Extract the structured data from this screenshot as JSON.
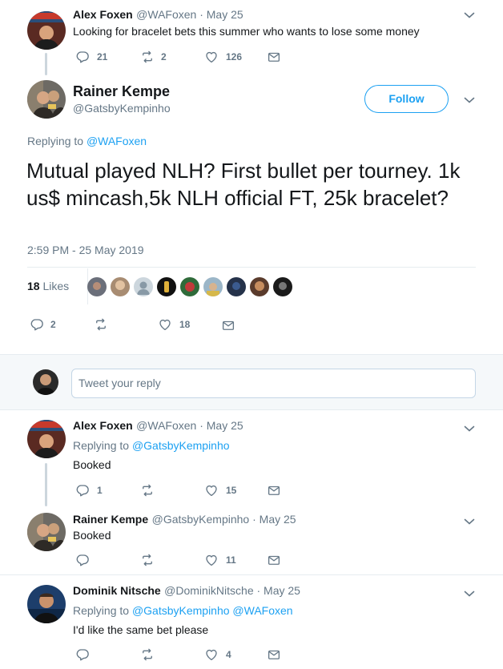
{
  "colors": {
    "accent": "#1da1f2",
    "muted": "#657786",
    "text": "#14171a",
    "divider": "#e6ecf0",
    "reply_bg": "#f5f8fa"
  },
  "tweet1": {
    "name": "Alex Foxen",
    "handle": "@WAFoxen · May 25",
    "text": "Looking for bracelet bets this summer who wants to lose some money",
    "replies": "21",
    "retweets": "2",
    "likes": "126"
  },
  "main": {
    "name": "Rainer Kempe",
    "handle": "@GatsbyKempinho",
    "follow_label": "Follow",
    "replying_prefix": "Replying to ",
    "replying_to": "@WAFoxen",
    "text": "Mutual played NLH? First bullet per tourney. 1k us$ mincash,5k NLH official FT, 25k bracelet?",
    "timestamp": "2:59 PM - 25 May 2019",
    "likes_count": "18",
    "likes_label": "Likes",
    "replies": "2",
    "likes": "18"
  },
  "compose": {
    "placeholder": "Tweet your reply"
  },
  "reply1": {
    "name": "Alex Foxen",
    "handle": "@WAFoxen · May 25",
    "replying_prefix": "Replying to ",
    "replying_to": "@GatsbyKempinho",
    "text": "Booked",
    "replies": "1",
    "likes": "15"
  },
  "reply2": {
    "name": "Rainer Kempe",
    "handle": "@GatsbyKempinho · May 25",
    "text": "Booked",
    "likes": "11"
  },
  "reply3": {
    "name": "Dominik Nitsche",
    "handle": "@DominikNitsche · May 25",
    "replying_prefix": "Replying to ",
    "replying_to": "@GatsbyKempinho @WAFoxen",
    "text": "I'd like the same bet please",
    "likes": "4"
  }
}
